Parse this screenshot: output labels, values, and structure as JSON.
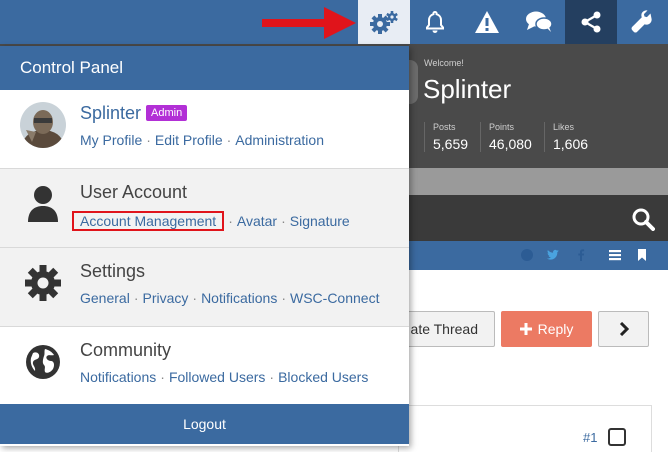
{
  "colors": {
    "brand_blue": "#3b6aa0",
    "dark_blue": "#243f60",
    "admin_badge": "#b22fd6",
    "reply_button": "#ec7a63",
    "highlight_red": "#e0141b",
    "annotation_arrow": "#e0141b"
  },
  "top_bar": {
    "icons": [
      "gears-icon",
      "bell-icon",
      "warning-icon",
      "chat-icon",
      "share-icon",
      "wrench-icon"
    ],
    "active": "gears-icon"
  },
  "profile_header": {
    "welcome": "Welcome!",
    "name": "Splinter",
    "stats": [
      {
        "label": "Posts",
        "value": "5,659"
      },
      {
        "label": "Points",
        "value": "46,080"
      },
      {
        "label": "Likes",
        "value": "1,606"
      }
    ]
  },
  "thread_controls": {
    "create_thread_label": "ate Thread",
    "reply_label": "Reply",
    "post_number": "#1"
  },
  "control_panel": {
    "title": "Control Panel",
    "user": {
      "name": "Splinter",
      "badge": "Admin",
      "links": [
        "My Profile",
        "Edit Profile",
        "Administration"
      ]
    },
    "sections": [
      {
        "title": "User Account",
        "links": [
          "Account Management",
          "Avatar",
          "Signature"
        ],
        "highlighted_link": "Account Management"
      },
      {
        "title": "Settings",
        "links": [
          "General",
          "Privacy",
          "Notifications",
          "WSC-Connect"
        ]
      },
      {
        "title": "Community",
        "links": [
          "Notifications",
          "Followed Users",
          "Blocked Users"
        ]
      }
    ],
    "logout_label": "Logout"
  },
  "separator": "·"
}
